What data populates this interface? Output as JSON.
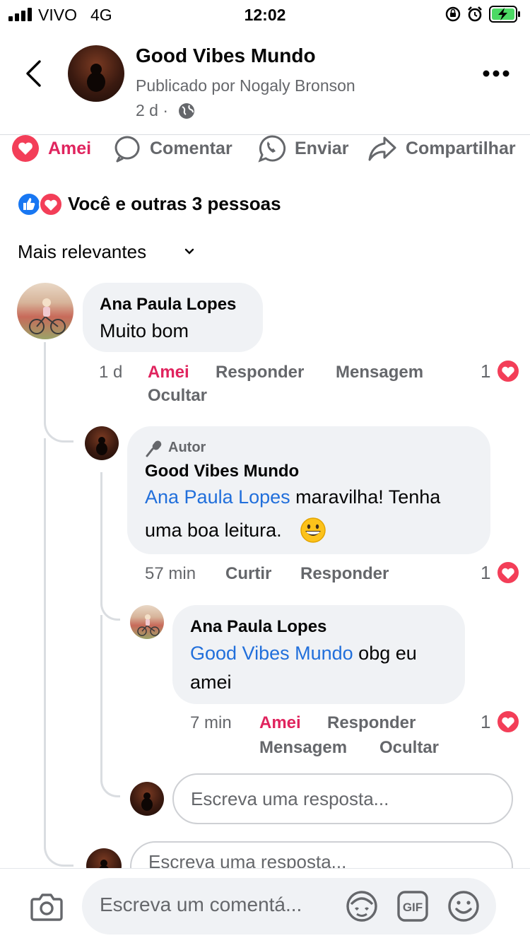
{
  "status_bar": {
    "carrier": "VIVO",
    "network": "4G",
    "time": "12:02"
  },
  "header": {
    "title": "Good Vibes Mundo",
    "subtitle": "Publicado por Nogaly Bronson",
    "age": "2 d ·"
  },
  "actions": {
    "love": "Amei",
    "comment": "Comentar",
    "send": "Enviar",
    "share": "Compartilhar"
  },
  "reactions": {
    "summary": "Você e outras 3 pessoas"
  },
  "sort": {
    "label": "Mais relevantes"
  },
  "comments": [
    {
      "author": "Ana Paula Lopes",
      "text": "Muito bom",
      "time": "1 d",
      "react": "Amei",
      "reply": "Responder",
      "message": "Mensagem",
      "hide": "Ocultar",
      "count": "1"
    },
    {
      "badge": "Autor",
      "author": "Good Vibes Mundo",
      "mention": "Ana Paula Lopes",
      "text_line1": " maravilha! Tenha",
      "text_line2": "uma boa leitura.",
      "time": "57 min",
      "like": "Curtir",
      "reply": "Responder",
      "count": "1"
    },
    {
      "author": "Ana Paula Lopes",
      "mention": "Good Vibes Mundo",
      "text_line1": " obg eu",
      "text_line2": "amei",
      "time": "7 min",
      "react": "Amei",
      "reply": "Responder",
      "message": "Mensagem",
      "hide": "Ocultar",
      "count": "1"
    }
  ],
  "reply_input": {
    "placeholder": "Escreva uma resposta..."
  },
  "composer": {
    "placeholder": "Escreva um comentá..."
  },
  "icons": [
    "signal-icon",
    "alarm-lock-icon",
    "alarm-icon",
    "battery-charging-icon",
    "back-icon",
    "more-icon",
    "globe-icon",
    "heart-icon",
    "comment-icon",
    "whatsapp-icon",
    "share-icon",
    "like-reaction-icon",
    "love-reaction-icon",
    "chevron-down-icon",
    "microphone-icon",
    "grin-emoji-icon",
    "camera-icon",
    "avatar-sticker-icon",
    "gif-icon",
    "emoji-icon"
  ],
  "colors": {
    "love": "#e0245e",
    "link": "#216fdb",
    "like": "#1877f2",
    "secondary_text": "#65676b",
    "bubble": "#f0f2f5"
  }
}
